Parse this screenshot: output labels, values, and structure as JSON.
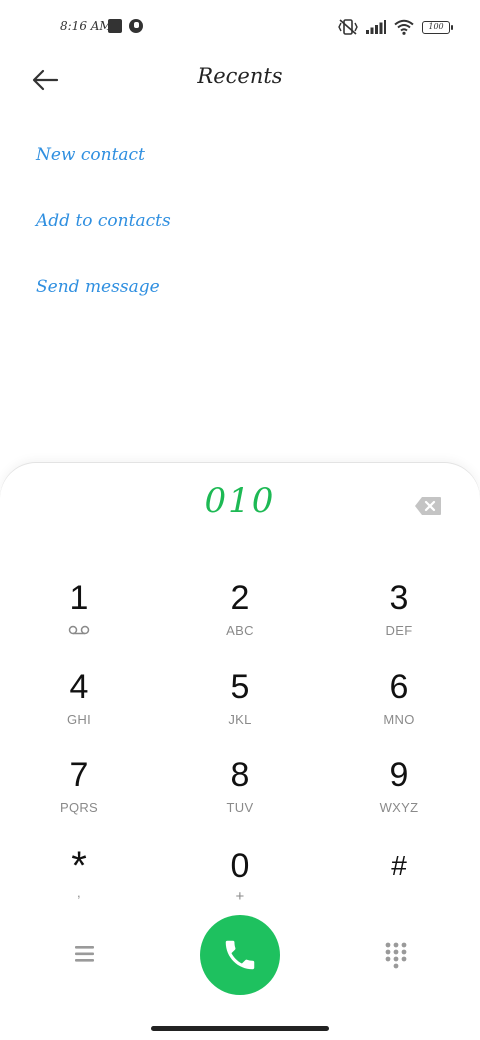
{
  "status_bar": {
    "time": "8:16 AM",
    "battery": "100"
  },
  "header": {
    "title": "Recents"
  },
  "actions": {
    "new_contact": "New contact",
    "add_to_contacts": "Add to contacts",
    "send_message": "Send message"
  },
  "dialer": {
    "number": "010"
  },
  "keypad": [
    {
      "digit": "1",
      "letters": "",
      "icon": "voicemail-icon"
    },
    {
      "digit": "2",
      "letters": "ABC"
    },
    {
      "digit": "3",
      "letters": "DEF"
    },
    {
      "digit": "4",
      "letters": "GHI"
    },
    {
      "digit": "5",
      "letters": "JKL"
    },
    {
      "digit": "6",
      "letters": "MNO"
    },
    {
      "digit": "7",
      "letters": "PQRS"
    },
    {
      "digit": "8",
      "letters": "TUV"
    },
    {
      "digit": "9",
      "letters": "WXYZ"
    },
    {
      "digit": "*",
      "letters": ","
    },
    {
      "digit": "0",
      "letters": "+"
    },
    {
      "digit": "#",
      "letters": ""
    }
  ],
  "colors": {
    "accent_blue": "#2f8fe0",
    "call_green": "#1ec15f",
    "number_green": "#1db954"
  }
}
